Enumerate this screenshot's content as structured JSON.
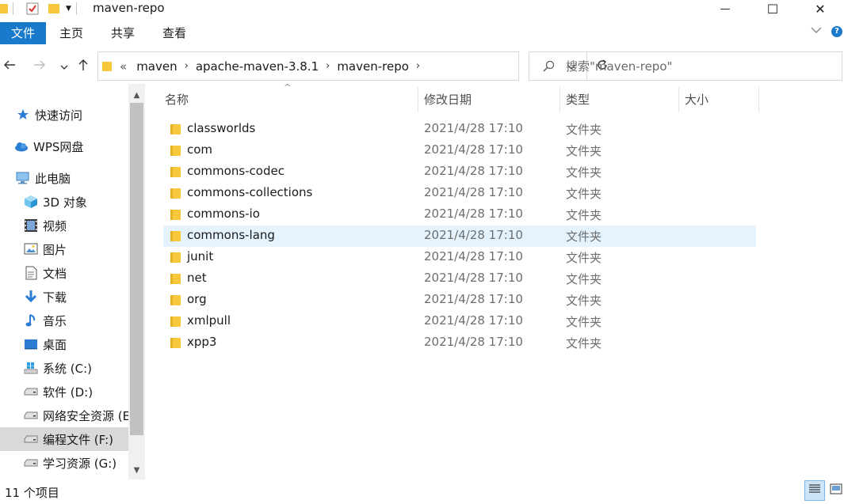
{
  "window": {
    "title": "maven-repo",
    "minimize_glyph": "—",
    "maximize_glyph": "☐",
    "close_glyph": "✕"
  },
  "ribbon": {
    "tabs": [
      "文件",
      "主页",
      "共享",
      "查看"
    ]
  },
  "address": {
    "overflow": "«",
    "crumbs": [
      "maven",
      "apache-maven-3.8.1",
      "maven-repo"
    ]
  },
  "search": {
    "placeholder": "搜索\"maven-repo\""
  },
  "nav": {
    "items": [
      {
        "label": "快速访问",
        "icon": "star-pin-icon"
      },
      {
        "label": "WPS网盘",
        "icon": "cloud-icon"
      },
      {
        "label": "此电脑",
        "icon": "computer-icon"
      },
      {
        "label": "3D 对象",
        "icon": "cube-3d-icon"
      },
      {
        "label": "视频",
        "icon": "video-icon"
      },
      {
        "label": "图片",
        "icon": "picture-icon"
      },
      {
        "label": "文档",
        "icon": "document-icon"
      },
      {
        "label": "下载",
        "icon": "download-icon"
      },
      {
        "label": "音乐",
        "icon": "music-icon"
      },
      {
        "label": "桌面",
        "icon": "desktop-icon"
      },
      {
        "label": "系统 (C:)",
        "icon": "windows-drive-icon"
      },
      {
        "label": "软件 (D:)",
        "icon": "drive-icon"
      },
      {
        "label": "网络安全资源 (E:",
        "icon": "drive-icon"
      },
      {
        "label": "编程文件 (F:)",
        "icon": "drive-icon",
        "selected": true
      },
      {
        "label": "学习资源 (G:)",
        "icon": "drive-icon"
      }
    ]
  },
  "columns": {
    "name": "名称",
    "date": "修改日期",
    "type": "类型",
    "size": "大小"
  },
  "files": [
    {
      "name": "classworlds",
      "date": "2021/4/28 17:10",
      "type": "文件夹"
    },
    {
      "name": "com",
      "date": "2021/4/28 17:10",
      "type": "文件夹"
    },
    {
      "name": "commons-codec",
      "date": "2021/4/28 17:10",
      "type": "文件夹"
    },
    {
      "name": "commons-collections",
      "date": "2021/4/28 17:10",
      "type": "文件夹"
    },
    {
      "name": "commons-io",
      "date": "2021/4/28 17:10",
      "type": "文件夹"
    },
    {
      "name": "commons-lang",
      "date": "2021/4/28 17:10",
      "type": "文件夹",
      "hover": true
    },
    {
      "name": "junit",
      "date": "2021/4/28 17:10",
      "type": "文件夹"
    },
    {
      "name": "net",
      "date": "2021/4/28 17:10",
      "type": "文件夹"
    },
    {
      "name": "org",
      "date": "2021/4/28 17:10",
      "type": "文件夹"
    },
    {
      "name": "xmlpull",
      "date": "2021/4/28 17:10",
      "type": "文件夹"
    },
    {
      "name": "xpp3",
      "date": "2021/4/28 17:10",
      "type": "文件夹"
    }
  ],
  "status": {
    "count_text": "11 个项目"
  },
  "colors": {
    "accent": "#1979ca",
    "folder": "#f8c83c",
    "hover_row": "#e5f3ff",
    "selected_nav": "#d9d9d9"
  }
}
